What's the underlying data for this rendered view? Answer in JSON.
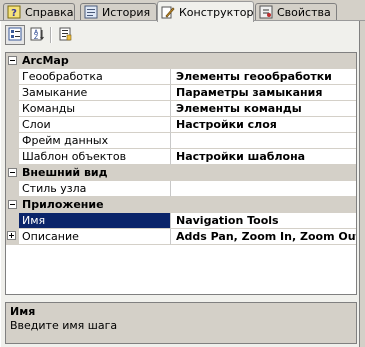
{
  "tabs": [
    {
      "label": "Справка",
      "icon": "help-book-icon"
    },
    {
      "label": "История",
      "icon": "history-icon"
    },
    {
      "label": "Конструктор",
      "icon": "designer-pencil-icon"
    },
    {
      "label": "Свойства",
      "icon": "properties-icon"
    }
  ],
  "toolbar": {
    "icons": [
      "categorized-view-icon",
      "alphabetical-view-icon",
      "property-pages-icon"
    ]
  },
  "grid": {
    "categories": {
      "arcmap": "ArcMap",
      "appearance": "Внешний вид",
      "application": "Приложение"
    },
    "rows": {
      "geoprocessing": {
        "name": "Геообработка",
        "value": "Элементы геообработки"
      },
      "snapping": {
        "name": "Замыкание",
        "value": "Параметры замыкания"
      },
      "commands": {
        "name": "Команды",
        "value": "Элементы команды"
      },
      "layers": {
        "name": "Слои",
        "value": "Настройки слоя"
      },
      "dataframe": {
        "name": "Фрейм данных",
        "value": ""
      },
      "template": {
        "name": "Шаблон объектов",
        "value": "Настройки шаблона"
      },
      "nodestyle": {
        "name": "Стиль узла",
        "value": ""
      },
      "name": {
        "name": "Имя",
        "value": "Navigation Tools"
      },
      "description": {
        "name": "Описание",
        "value": "Adds Pan, Zoom In, Zoom Out t"
      }
    }
  },
  "help": {
    "title": "Имя",
    "text": "Введите имя шага"
  }
}
